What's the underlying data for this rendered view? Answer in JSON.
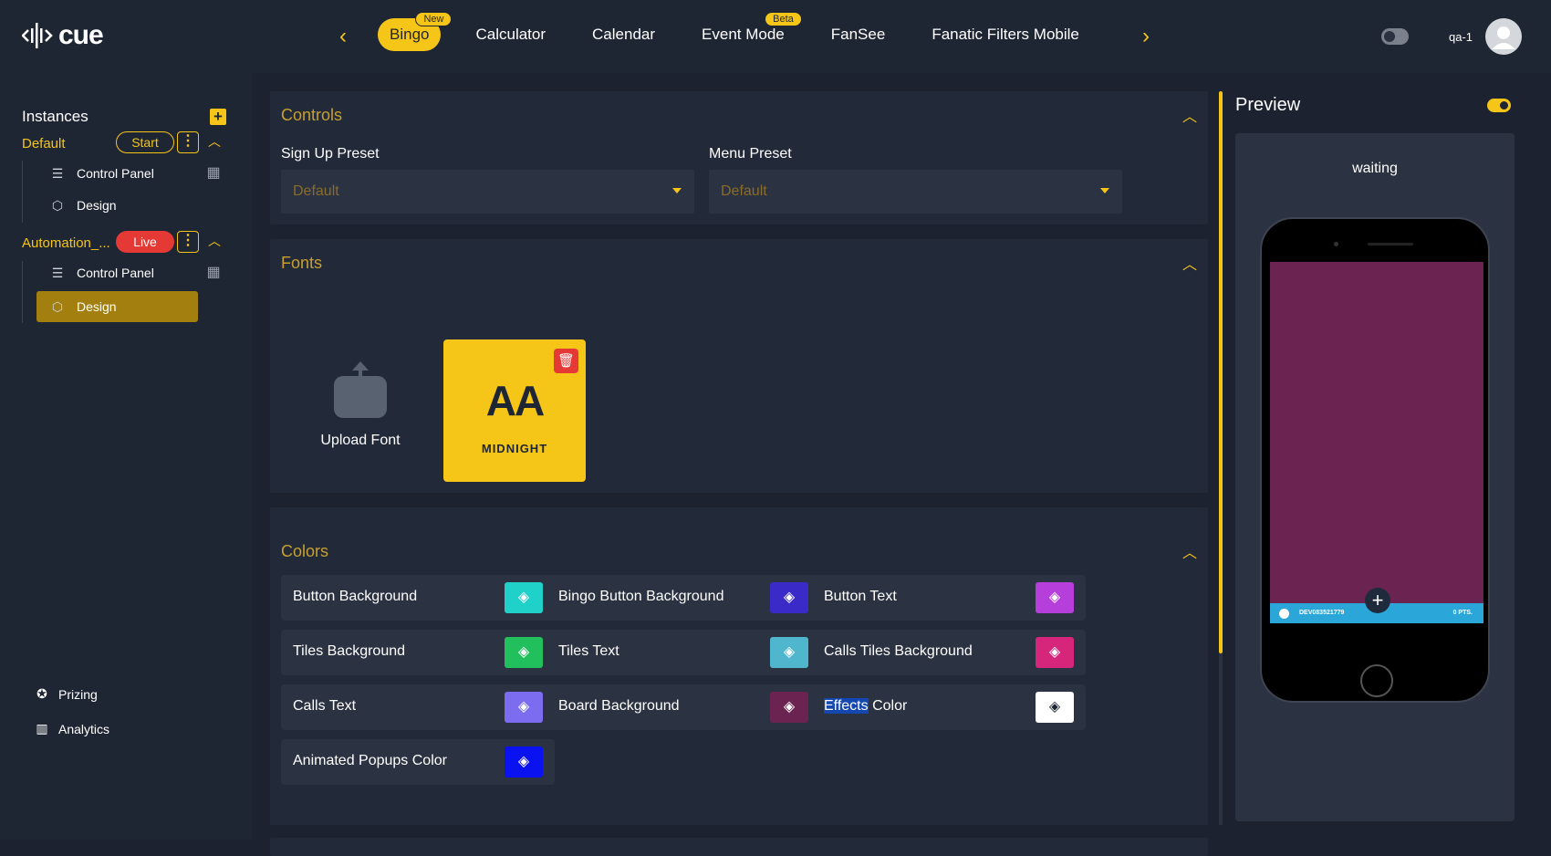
{
  "app": {
    "logo_text": "cue"
  },
  "topnav": {
    "tabs": [
      {
        "label": "Bingo",
        "badge": "New",
        "active": true
      },
      {
        "label": "Calculator"
      },
      {
        "label": "Calendar"
      },
      {
        "label": "Event Mode",
        "badge": "Beta"
      },
      {
        "label": "FanSee"
      },
      {
        "label": "Fanatic Filters Mobile"
      }
    ],
    "user_name": "qa-1"
  },
  "sidebar": {
    "title": "Instances",
    "instances": [
      {
        "name": "Default",
        "status": "Start",
        "items": [
          {
            "label": "Control Panel",
            "icon": "sliders-icon"
          },
          {
            "label": "Design",
            "icon": "cube-icon"
          }
        ]
      },
      {
        "name": "Automation_...",
        "status": "Live",
        "items": [
          {
            "label": "Control Panel",
            "icon": "sliders-icon"
          },
          {
            "label": "Design",
            "icon": "cube-icon",
            "active": true
          }
        ]
      }
    ],
    "bottom": [
      {
        "label": "Prizing",
        "icon": "award-icon"
      },
      {
        "label": "Analytics",
        "icon": "chart-icon"
      }
    ]
  },
  "controls": {
    "title": "Controls",
    "signup_label": "Sign Up Preset",
    "signup_value": "Default",
    "menu_label": "Menu Preset",
    "menu_value": "Default"
  },
  "fonts": {
    "title": "Fonts",
    "upload_label": "Upload Font",
    "card_preview": "AA",
    "card_name": "MIDNIGHT"
  },
  "colors": {
    "title": "Colors",
    "items": [
      {
        "label": "Button Background",
        "color": "#1fd1c9"
      },
      {
        "label": "Bingo Button Background",
        "color": "#3a2bc9"
      },
      {
        "label": "Button Text",
        "color": "#b63fdc"
      },
      {
        "label": "Tiles Background",
        "color": "#22c05c"
      },
      {
        "label": "Tiles Text",
        "color": "#4fb6cd"
      },
      {
        "label": "Calls Tiles Background",
        "color": "#d6267b"
      },
      {
        "label": "Calls Text",
        "color": "#7b6cf0"
      },
      {
        "label": "Board Background",
        "color": "#6b2451"
      },
      {
        "label": "Effects Color",
        "highlight": "Effects",
        "rest": " Color",
        "color": "#ffffff"
      },
      {
        "label": "Animated Popups Color",
        "color": "#0a12f0"
      }
    ]
  },
  "preview": {
    "title": "Preview",
    "status": "waiting",
    "phone_left": "DEV083521779",
    "phone_right": "0 PTS."
  },
  "palette": {
    "accent": "#f5c518",
    "live": "#e53935",
    "bg": "#1c2230"
  }
}
